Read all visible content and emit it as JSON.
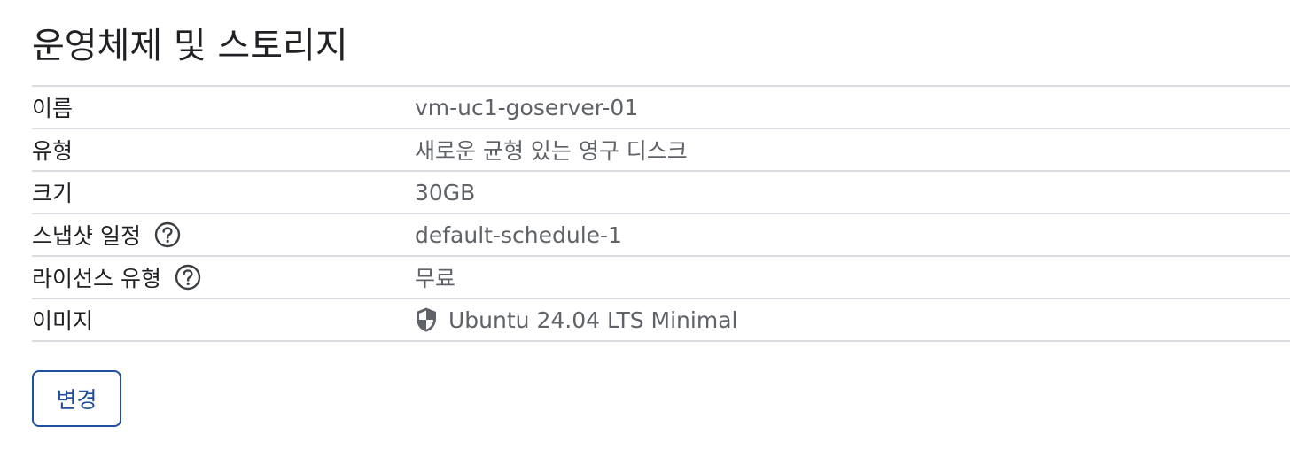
{
  "section": {
    "title": "운영체제 및 스토리지"
  },
  "rows": [
    {
      "label": "이름",
      "value": "vm-uc1-goserver-01"
    },
    {
      "label": "유형",
      "value": "새로운 균형 있는 영구 디스크"
    },
    {
      "label": "크기",
      "value": "30GB"
    },
    {
      "label": "스냅샷 일정",
      "value": "default-schedule-1",
      "help_icon": "help-circle-icon"
    },
    {
      "label": "라이선스 유형",
      "value": "무료",
      "help_icon": "help-circle-icon"
    },
    {
      "label": "이미지",
      "value": "Ubuntu 24.04 LTS Minimal",
      "value_icon": "shield-icon"
    }
  ],
  "actions": {
    "change_label": "변경"
  },
  "colors": {
    "text_primary": "#202124",
    "text_secondary": "#5f6368",
    "divider": "#dadce0",
    "button_accent": "#1f4f9e"
  }
}
